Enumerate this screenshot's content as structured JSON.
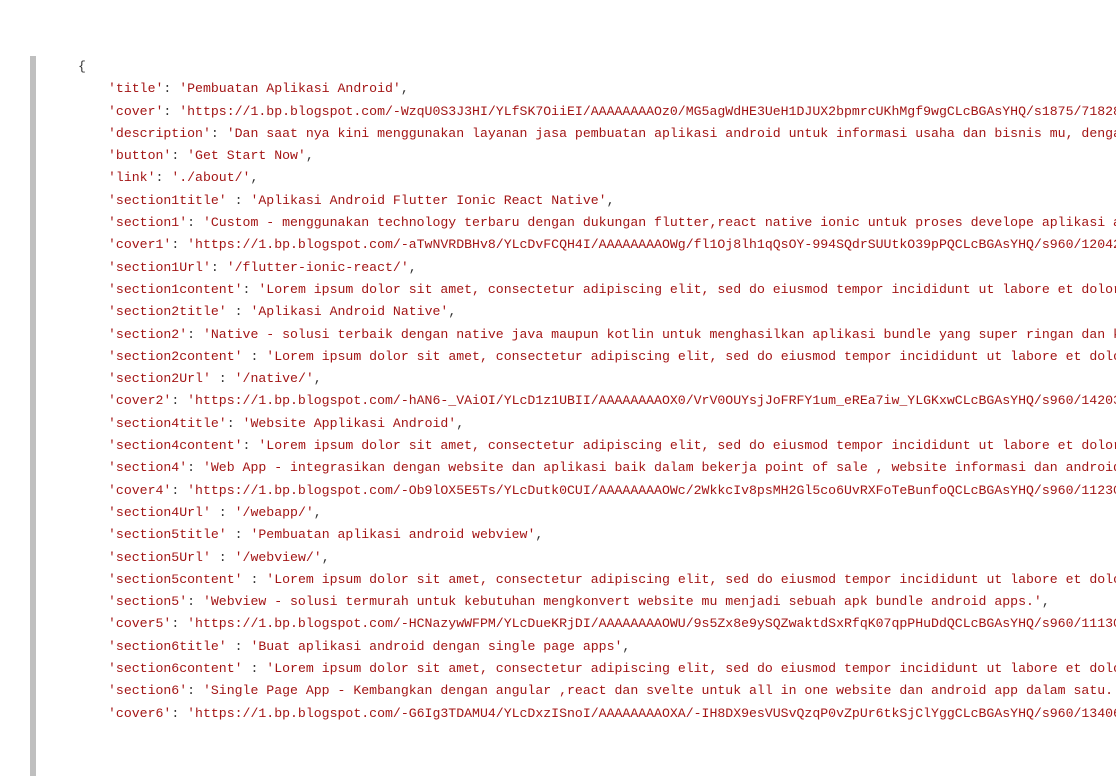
{
  "code_config": {
    "open_brace": "{",
    "entries": [
      {
        "key": "title",
        "value": "Pembuatan Aplikasi Android",
        "trailing_comma": true
      },
      {
        "key": "cover",
        "value": "https://1.bp.blogspot.com/-WzqU0S3J3HI/YLfSK7OiiEI/AAAAAAAAOz0/MG5agWdHE3UeH1DJUX2bpmrcUKhMgf9wgCLcBGAsYHQ/s1875/7182874",
        "truncated": true
      },
      {
        "key": "description",
        "value": "Dan saat nya kini menggunakan layanan jasa pembuatan aplikasi android untuk informasi usaha dan bisnis mu, dengan ",
        "truncated": true
      },
      {
        "key": "button",
        "value": "Get Start Now",
        "trailing_comma": true
      },
      {
        "key": "link",
        "value": "./about/",
        "trailing_comma": true
      },
      {
        "key": "section1title",
        "space_before_colon": true,
        "value": "Aplikasi Android Flutter Ionic React Native",
        "trailing_comma": true
      },
      {
        "key": "section1",
        "value": "Custom - menggunakan technology terbaru dengan dukungan flutter,react native ionic untuk proses develope aplikasi and",
        "truncated": true
      },
      {
        "key": "cover1",
        "value": "https://1.bp.blogspot.com/-aTwNVRDBHv8/YLcDvFCQH4I/AAAAAAAAOWg/fl1Oj8lh1qQsOY-994SQdrSUUtkO39pPQCLcBGAsYHQ/s960/1204268",
        "truncated": true
      },
      {
        "key": "section1Url",
        "value": "/flutter-ionic-react/",
        "trailing_comma": true
      },
      {
        "key": "section1content",
        "value": "Lorem ipsum dolor sit amet, consectetur adipiscing elit, sed do eiusmod tempor incididunt ut labore et dolore ",
        "truncated": true
      },
      {
        "key": "section2title",
        "space_before_colon": true,
        "value": "Aplikasi Android Native",
        "trailing_comma": true
      },
      {
        "key": "section2",
        "value": "Native - solusi terbaik dengan native java maupun kotlin untuk menghasilkan aplikasi bundle yang super ringan dan kec",
        "truncated": true
      },
      {
        "key": "section2content",
        "space_before_colon": true,
        "value": "Lorem ipsum dolor sit amet, consectetur adipiscing elit, sed do eiusmod tempor incididunt ut labore et dolore",
        "truncated": true
      },
      {
        "key": "section2Url",
        "space_before_colon": true,
        "value": "/native/",
        "trailing_comma": true
      },
      {
        "key": "cover2",
        "value": "https://1.bp.blogspot.com/-hAN6-_VAiOI/YLcD1z1UBII/AAAAAAAAOX0/VrV0OUYsjJoFRFY1um_eREa7iw_YLGKxwCLcBGAsYHQ/s960/1420313",
        "truncated": true
      },
      {
        "key": "section4title",
        "value": "Website Applikasi Android",
        "trailing_comma": true
      },
      {
        "key": "section4content",
        "value": "Lorem ipsum dolor sit amet, consectetur adipiscing elit, sed do eiusmod tempor incididunt ut labore et dolore ",
        "truncated": true
      },
      {
        "key": "section4",
        "value": "Web App - integrasikan dengan website dan aplikasi baik dalam bekerja point of sale , website informasi dan android a",
        "truncated": true
      },
      {
        "key": "cover4",
        "value": "https://1.bp.blogspot.com/-Ob9lOX5E5Ts/YLcDutk0CUI/AAAAAAAAOWc/2WkkcIv8psMH2Gl5co6UvRXFoTeBunfoQCLcBGAsYHQ/s960/1123065",
        "truncated": true
      },
      {
        "key": "section4Url",
        "space_before_colon": true,
        "value": "/webapp/",
        "trailing_comma": true
      },
      {
        "key": "section5title",
        "space_before_colon": true,
        "value": "Pembuatan aplikasi android webview",
        "trailing_comma": true
      },
      {
        "key": "section5Url",
        "space_before_colon": true,
        "value": "/webview/",
        "trailing_comma": true
      },
      {
        "key": "section5content",
        "space_before_colon": true,
        "value": "Lorem ipsum dolor sit amet, consectetur adipiscing elit, sed do eiusmod tempor incididunt ut labore et dolore",
        "truncated": true
      },
      {
        "key": "section5",
        "value": "Webview - solusi termurah untuk kebutuhan mengkonvert website mu menjadi sebuah apk bundle android apps.",
        "trailing_comma": true
      },
      {
        "key": "cover5",
        "value": "https://1.bp.blogspot.com/-HCNazywWFPM/YLcDueKRjDI/AAAAAAAAOWU/9s5Zx8e9ySQZwaktdSxRfqK07qpPHuDdQCLcBGAsYHQ/s960/1113016",
        "truncated": true
      },
      {
        "key": "section6title",
        "space_before_colon": true,
        "value": "Buat aplikasi android dengan single page apps",
        "trailing_comma": true
      },
      {
        "key": "section6content",
        "space_before_colon": true,
        "value": "Lorem ipsum dolor sit amet, consectetur adipiscing elit, sed do eiusmod tempor incididunt ut labore et dolore",
        "truncated": true
      },
      {
        "key": "section6",
        "value": "Single Page App - Kembangkan dengan angular ,react dan svelte untuk all in one website dan android app dalam satu.",
        "trailing_comma": true
      },
      {
        "key": "cover6",
        "value": "https://1.bp.blogspot.com/-G6Ig3TDAMU4/YLcDxzISnoI/AAAAAAAAOXA/-IH8DX9esVUSvQzqP0vZpUr6tkSjClYggCLcBGAsYHQ/s960/1340680",
        "truncated": true
      }
    ]
  }
}
